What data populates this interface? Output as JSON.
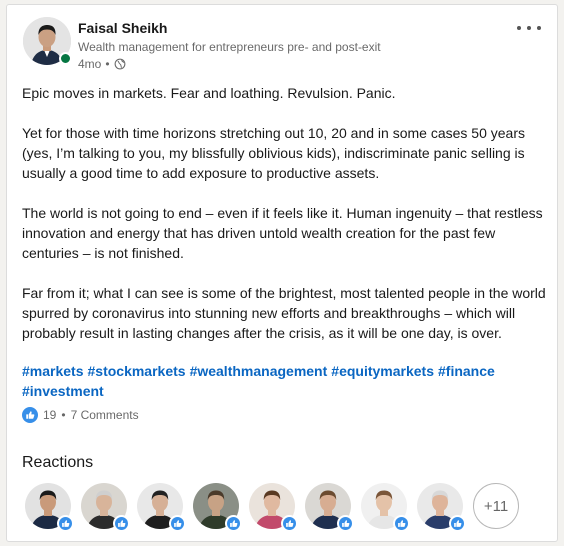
{
  "author": {
    "name": "Faisal Sheikh",
    "headline": "Wealth management for entrepreneurs pre- and post-exit",
    "time": "4mo",
    "separator": "•",
    "visibility_icon": "globe-icon",
    "online": true
  },
  "post": {
    "paragraphs": [
      "Epic moves in markets. Fear and loathing. Revulsion. Panic.",
      "Yet for those with time horizons stretching out 10, 20 and in some cases 50 years (yes, I’m talking to you, my blissfully oblivious kids), indiscriminate panic selling is usually a good time to add exposure to productive assets.",
      "The world is not going to end – even if it feels like it. Human ingenuity – that restless innovation and energy that has driven untold wealth creation for the past few centuries – is not finished.",
      "Far from it; what I can see is some of the brightest, most talented people in the world spurred by coronavirus into stunning new efforts and breakthroughs – which will probably result in lasting changes after the crisis, as it will be one day, is over."
    ],
    "hashtags": [
      "#markets",
      "#stockmarkets",
      "#wealthmanagement",
      "#equitymarkets",
      "#finance",
      "#investment"
    ]
  },
  "social": {
    "likes": "19",
    "separator": "•",
    "comments": "7 Comments"
  },
  "reactions": {
    "title": "Reactions",
    "more": "+11",
    "reactors": [
      {
        "skin": "#c99a7a",
        "hair": "#1a1a1a",
        "shirt": "#1c2a44",
        "bg": "#e2e2e2"
      },
      {
        "skin": "#d8b49a",
        "hair": "#cfcfcf",
        "shirt": "#2c2c2c",
        "bg": "#d9d6d0"
      },
      {
        "skin": "#d6b096",
        "hair": "#222222",
        "shirt": "#1e1e1e",
        "bg": "#e8e8e8"
      },
      {
        "skin": "#c7a285",
        "hair": "#4a3a2a",
        "shirt": "#2f3b2a",
        "bg": "#8a8f86"
      },
      {
        "skin": "#e0b9a0",
        "hair": "#5a3a22",
        "shirt": "#c24a6b",
        "bg": "#eae3dc"
      },
      {
        "skin": "#d7ad92",
        "hair": "#6b4b30",
        "shirt": "#1f2f4f",
        "bg": "#dad8d4"
      },
      {
        "skin": "#e4c2a8",
        "hair": "#7a5538",
        "shirt": "#e6e6e6",
        "bg": "#f0f0f0"
      },
      {
        "skin": "#deb49a",
        "hair": "#d8d8d8",
        "shirt": "#2a3d6a",
        "bg": "#e9e9e9"
      }
    ]
  },
  "colors": {
    "link": "#0a66c2",
    "like_blue": "#378fe9",
    "online_green": "#057642"
  }
}
